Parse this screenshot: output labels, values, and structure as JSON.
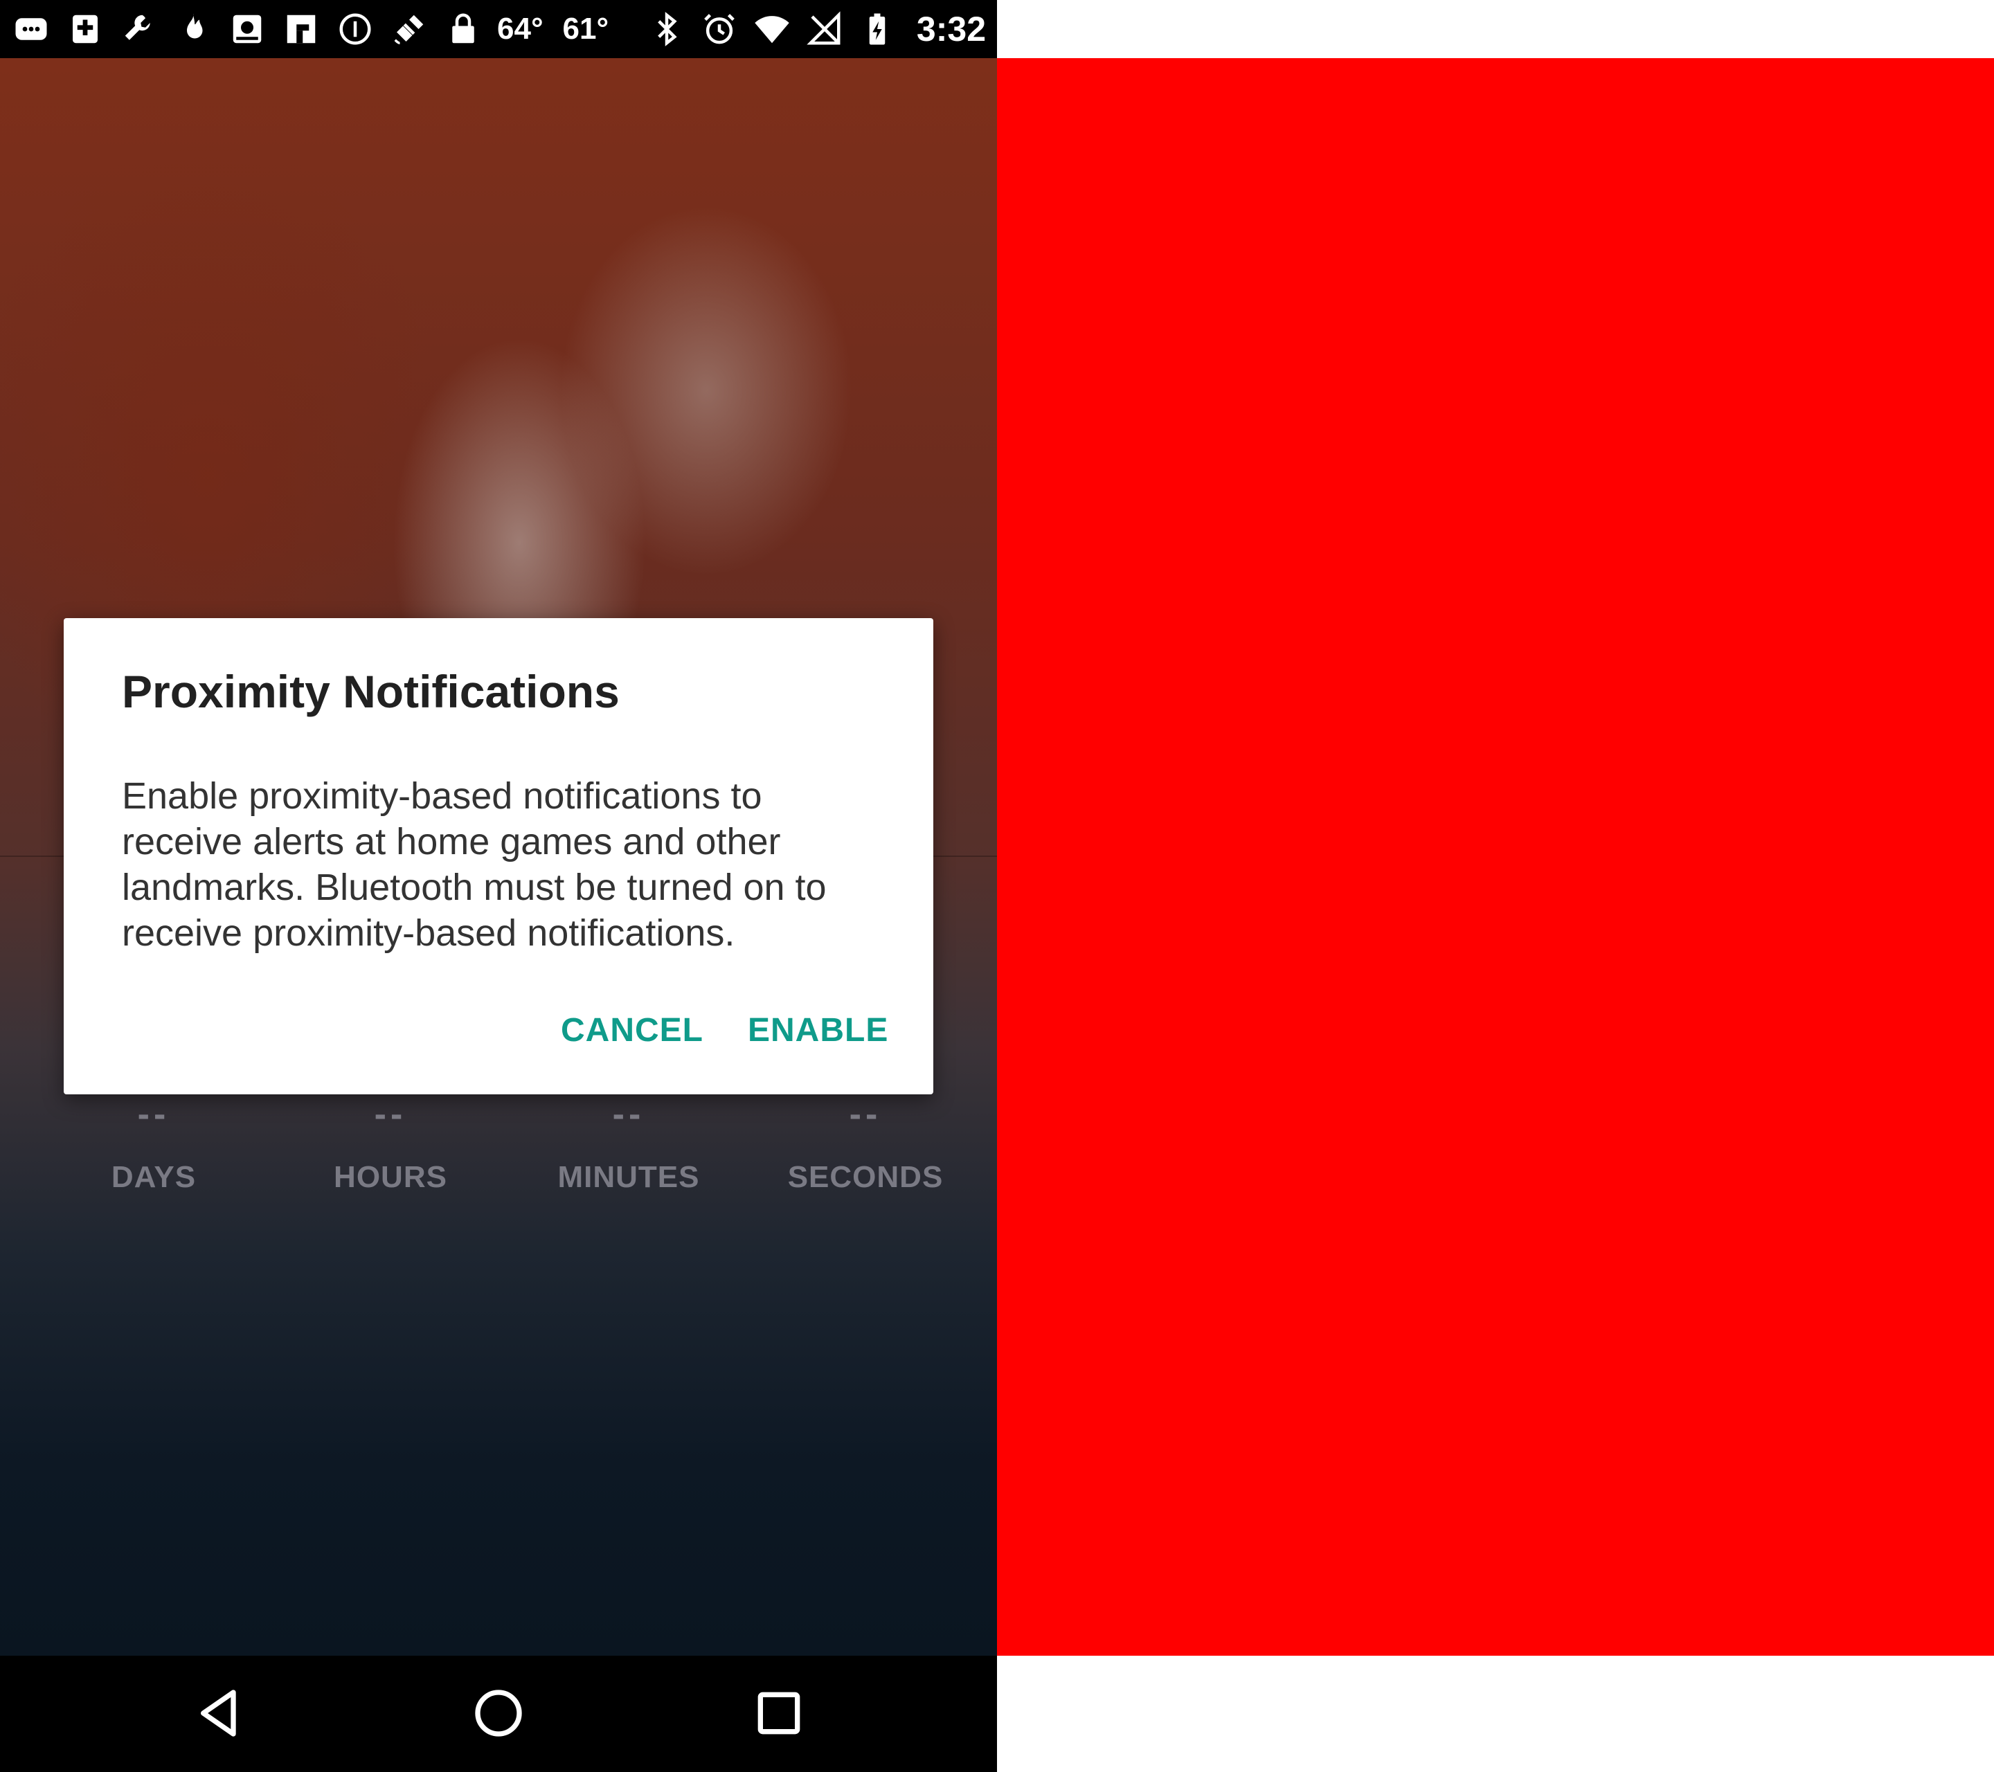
{
  "status_bar": {
    "temperature_1": "64°",
    "temperature_2": "61°",
    "time": "3:32",
    "icons": [
      "messages-icon",
      "medical-plus-icon",
      "wrench-icon",
      "flame-icon",
      "photo-icon",
      "flipboard-icon",
      "info-circle-icon",
      "fake-gps-satellite-icon",
      "lock-icon",
      "bluetooth-icon",
      "alarm-icon",
      "wifi-icon",
      "no-signal-icon",
      "battery-charging-icon"
    ]
  },
  "countdown": {
    "days_value": "--",
    "hours_value": "--",
    "minutes_value": "--",
    "seconds_value": "--",
    "days_label": "DAYS",
    "hours_label": "HOURS",
    "minutes_label": "MINUTES",
    "seconds_label": "SECONDS"
  },
  "dialog": {
    "title": "Proximity Notifications",
    "message": "Enable proximity-based notifications to receive alerts at home games and other landmarks. Bluetooth must be turned on to receive proximity-based notifications.",
    "cancel_label": "CANCEL",
    "enable_label": "ENABLE"
  },
  "nav": {
    "icons": [
      "back-icon",
      "home-icon",
      "recents-icon"
    ]
  },
  "colors": {
    "accent": "#0f9b8a",
    "red_panel": "#ff0000",
    "status_bar": "#000000"
  }
}
